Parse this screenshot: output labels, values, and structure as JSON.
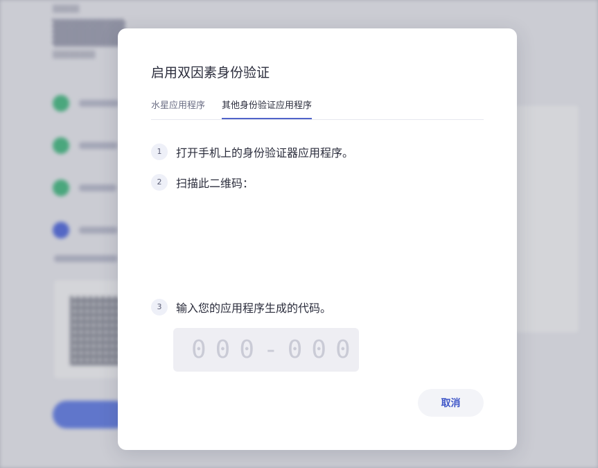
{
  "dialog": {
    "title": "启用双因素身份验证",
    "tabs": [
      {
        "label": "水星应用程序",
        "active": false
      },
      {
        "label": "其他身份验证应用程序",
        "active": true
      }
    ],
    "steps": [
      {
        "number": "1",
        "text": "打开手机上的身份验证器应用程序。"
      },
      {
        "number": "2",
        "text": "扫描此二维码："
      },
      {
        "number": "3",
        "text": "输入您的应用程序生成的代码。"
      }
    ],
    "code_input": {
      "value": "",
      "placeholder": "000-000"
    },
    "cancel_label": "取消"
  },
  "colors": {
    "accent": "#4f63c9",
    "cancel_text": "#3f56c8",
    "title_text": "#2b2d3c",
    "overlay": "#c9cad3"
  }
}
